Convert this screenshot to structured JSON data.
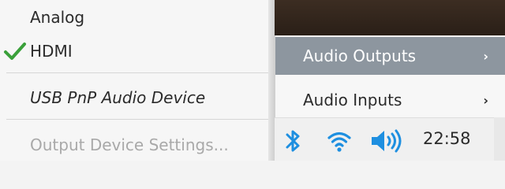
{
  "output_menu": {
    "items": [
      {
        "label": "Analog",
        "checked": false
      },
      {
        "label": "HDMI",
        "checked": true
      },
      {
        "label": "USB PnP Audio Device",
        "checked": false
      }
    ],
    "settings_label": "Output Device Settings..."
  },
  "audio_menu": {
    "outputs_label": "Audio Outputs",
    "inputs_label": "Audio Inputs",
    "chevron": "›"
  },
  "taskbar": {
    "icons": [
      "bluetooth-icon",
      "wifi-icon",
      "volume-icon"
    ],
    "clock": "22:58"
  },
  "colors": {
    "accent_blue": "#1e8fe0",
    "check_green": "#3aa03a",
    "highlight": "#8d969f"
  }
}
